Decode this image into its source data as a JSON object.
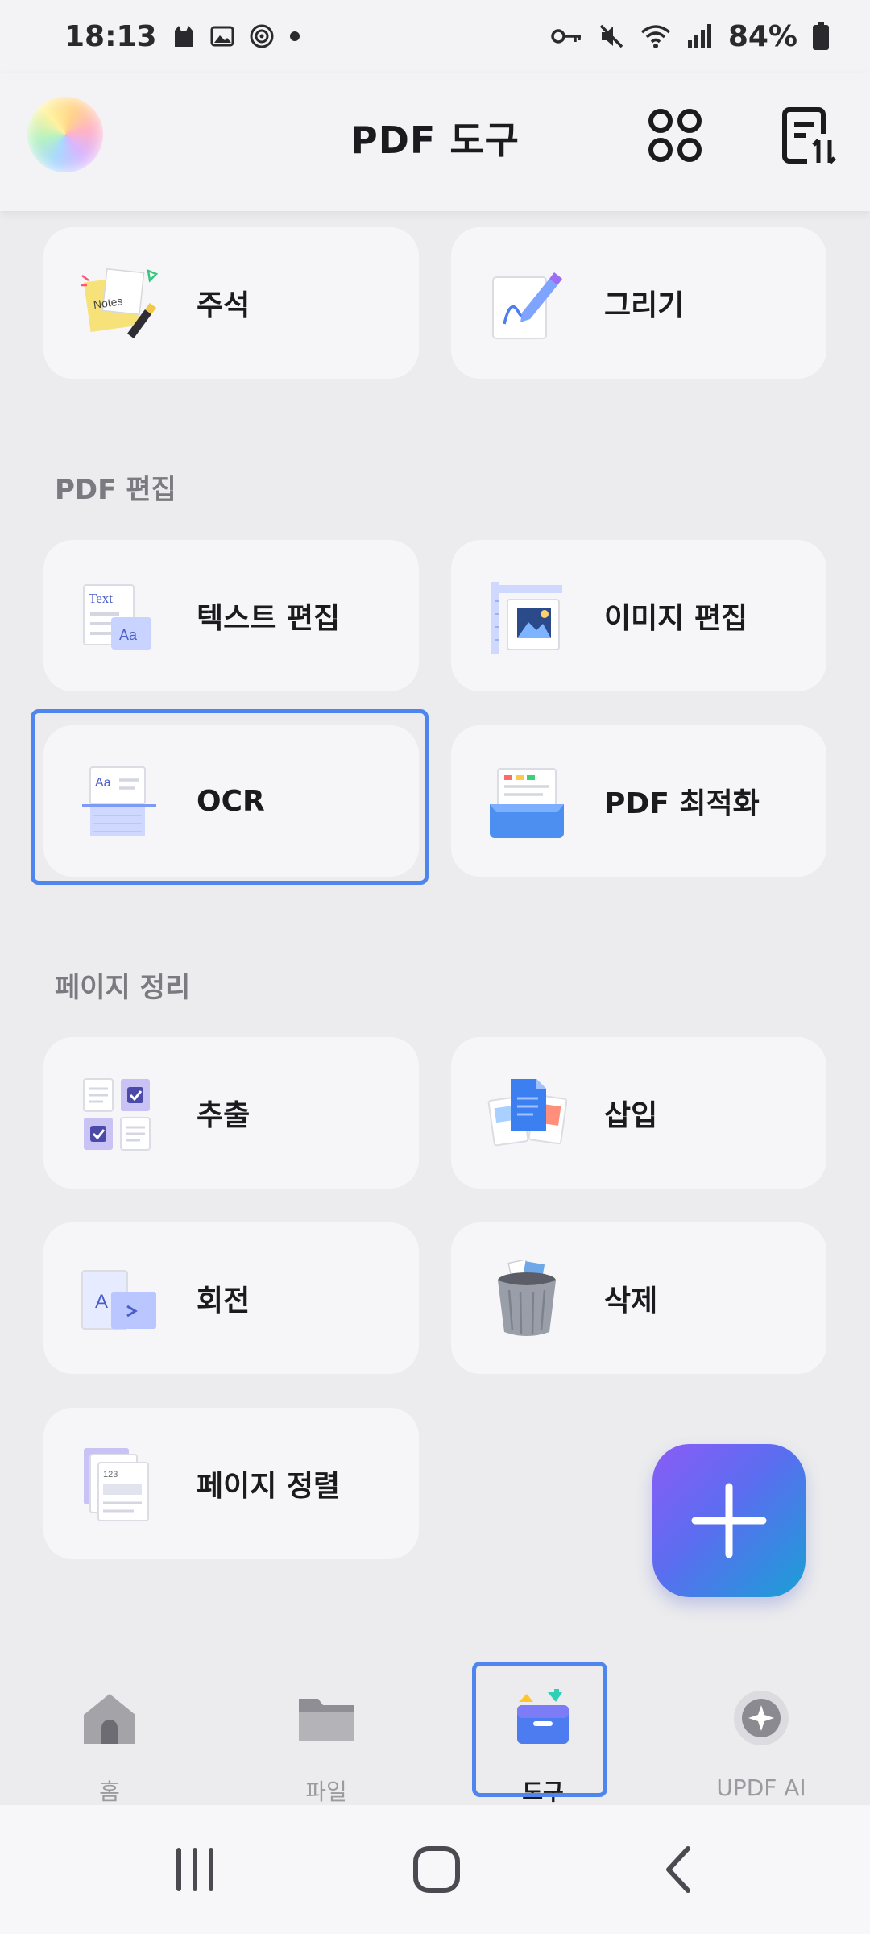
{
  "status": {
    "time": "18:13",
    "battery": "84%"
  },
  "header": {
    "title": "PDF 도구"
  },
  "top_tools": [
    {
      "label": "주석"
    },
    {
      "label": "그리기"
    }
  ],
  "sections": {
    "edit": {
      "title": "PDF 편집",
      "items": [
        {
          "label": "텍스트 편집"
        },
        {
          "label": "이미지 편집"
        },
        {
          "label": "OCR"
        },
        {
          "label": "PDF 최적화"
        }
      ]
    },
    "pages": {
      "title": "페이지 정리",
      "items": [
        {
          "label": "추출"
        },
        {
          "label": "삽입"
        },
        {
          "label": "회전"
        },
        {
          "label": "삭제"
        },
        {
          "label": "페이지 정렬"
        }
      ]
    }
  },
  "bottom_nav": [
    {
      "label": "홈"
    },
    {
      "label": "파일"
    },
    {
      "label": "도구"
    },
    {
      "label": "UPDF AI"
    }
  ],
  "icon_text": {
    "notes": "Notes",
    "text": "Text",
    "aa": "Aa",
    "a": "A",
    "num": "123"
  },
  "colors": {
    "accent": "#4f86ee",
    "background": "#ececee",
    "card": "#f6f6f8"
  }
}
